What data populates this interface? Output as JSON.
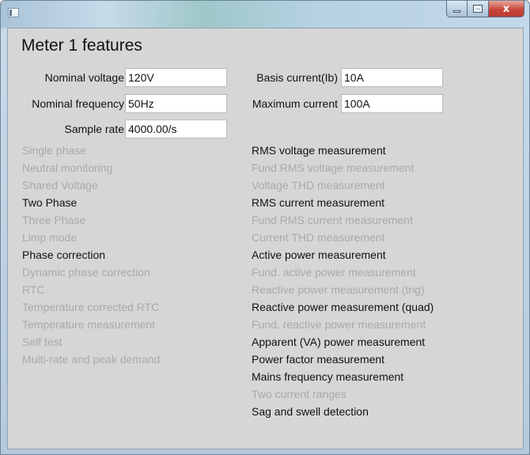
{
  "window": {
    "title": ""
  },
  "page_title": "Meter 1 features",
  "fields": [
    {
      "label": "Nominal voltage",
      "value": "120V"
    },
    {
      "label": "Nominal frequency",
      "value": "50Hz"
    },
    {
      "label": "Sample rate",
      "value": "4000.00/s"
    },
    {
      "label": "Basis current(Ib)",
      "value": "10A"
    },
    {
      "label": "Maximum current",
      "value": "100A"
    }
  ],
  "left_features": [
    {
      "label": "Single phase",
      "enabled": false
    },
    {
      "label": "Neutral monitoring",
      "enabled": false
    },
    {
      "label": "Shared Voltage",
      "enabled": false
    },
    {
      "label": "Two Phase",
      "enabled": true
    },
    {
      "label": "Three Phase",
      "enabled": false
    },
    {
      "label": "Limp mode",
      "enabled": false
    },
    {
      "label": "Phase correction",
      "enabled": true
    },
    {
      "label": "Dynamic phase correction",
      "enabled": false
    },
    {
      "label": "RTC",
      "enabled": false
    },
    {
      "label": "Temperature corrected RTC",
      "enabled": false
    },
    {
      "label": "Temperature measurement",
      "enabled": false
    },
    {
      "label": "Self test",
      "enabled": false
    },
    {
      "label": "Multi-rate and peak demand",
      "enabled": false
    }
  ],
  "right_features": [
    {
      "label": "RMS voltage measurement",
      "enabled": true
    },
    {
      "label": "Fund RMS voltage measurement",
      "enabled": false
    },
    {
      "label": "Voltage THD measurement",
      "enabled": false
    },
    {
      "label": "RMS current measurement",
      "enabled": true
    },
    {
      "label": "Fund RMS current measurement",
      "enabled": false
    },
    {
      "label": "Current THD measurement",
      "enabled": false
    },
    {
      "label": "Active power measurement",
      "enabled": true
    },
    {
      "label": "Fund. active power measurement",
      "enabled": false
    },
    {
      "label": "Reactive power measurement (trig)",
      "enabled": false
    },
    {
      "label": "Reactive power measurement (quad)",
      "enabled": true
    },
    {
      "label": "Fund. reactive power measurement",
      "enabled": false
    },
    {
      "label": "Apparent (VA) power measurement",
      "enabled": true
    },
    {
      "label": "Power factor measurement",
      "enabled": true
    },
    {
      "label": "Mains frequency measurement",
      "enabled": true
    },
    {
      "label": "Two current ranges",
      "enabled": false
    },
    {
      "label": "Sag and swell detection",
      "enabled": true
    }
  ],
  "controls": {
    "minimize": "",
    "maximize": "",
    "close": "x"
  }
}
